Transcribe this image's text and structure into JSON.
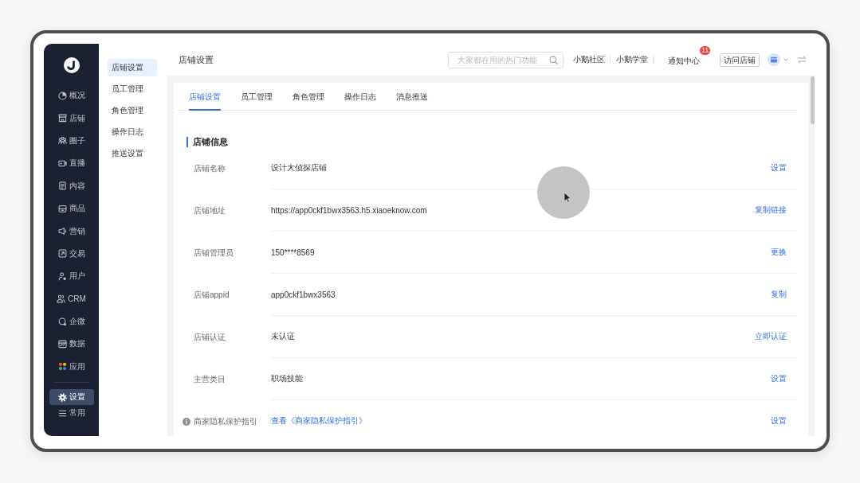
{
  "sidebar": {
    "items": [
      {
        "label": "概况",
        "selected": false
      },
      {
        "label": "店铺",
        "selected": false
      },
      {
        "label": "圈子",
        "selected": false
      },
      {
        "label": "直播",
        "selected": false
      },
      {
        "label": "内容",
        "selected": false
      },
      {
        "label": "商品",
        "selected": false
      },
      {
        "label": "营销",
        "selected": false
      },
      {
        "label": "交易",
        "selected": false
      },
      {
        "label": "用户",
        "selected": false
      },
      {
        "label": "CRM",
        "selected": false
      },
      {
        "label": "企微",
        "selected": false
      },
      {
        "label": "数据",
        "selected": false
      },
      {
        "label": "应用",
        "selected": false
      }
    ],
    "bottom_items": [
      {
        "label": "设置",
        "selected": true
      },
      {
        "label": "常用",
        "selected": false
      }
    ]
  },
  "subnav": {
    "items": [
      {
        "label": "店铺设置",
        "selected": true
      },
      {
        "label": "员工管理",
        "selected": false
      },
      {
        "label": "角色管理",
        "selected": false
      },
      {
        "label": "操作日志",
        "selected": false
      },
      {
        "label": "推送设置",
        "selected": false
      }
    ]
  },
  "header": {
    "title": "店铺设置",
    "search": {
      "placeholder": "大家都在用的热门功能"
    },
    "links": [
      "小鹅社区",
      "小鹅学堂"
    ],
    "notifications": {
      "label": "通知中心",
      "badge": "11"
    },
    "visit_button": "访问店铺"
  },
  "tabs": [
    {
      "label": "店铺设置",
      "selected": true
    },
    {
      "label": "员工管理",
      "selected": false
    },
    {
      "label": "角色管理",
      "selected": false
    },
    {
      "label": "操作日志",
      "selected": false
    },
    {
      "label": "消息推送",
      "selected": false
    }
  ],
  "section": {
    "title": "店铺信息",
    "rows": [
      {
        "kind": "text",
        "label": "店铺名称",
        "value": "设计大侦探店铺",
        "action": "设置"
      },
      {
        "kind": "text",
        "label": "店铺地址",
        "value": "https://app0ckf1bwx3563.h5.xiaoeknow.com",
        "action": "复制链接"
      },
      {
        "kind": "text",
        "label": "店铺管理员",
        "value": "150****8569",
        "action": "更换"
      },
      {
        "kind": "text",
        "label": "店铺appid",
        "value": "app0ckf1bwx3563",
        "action": "复制"
      },
      {
        "kind": "text",
        "label": "店铺认证",
        "value": "未认证",
        "action": "立即认证"
      },
      {
        "kind": "text",
        "label": "主营类目",
        "value": "职场技能",
        "action": "设置"
      },
      {
        "kind": "guide",
        "label": "商家隐私保护指引",
        "value": "查看《商家隐私保护指引》",
        "action": "设置"
      }
    ]
  }
}
